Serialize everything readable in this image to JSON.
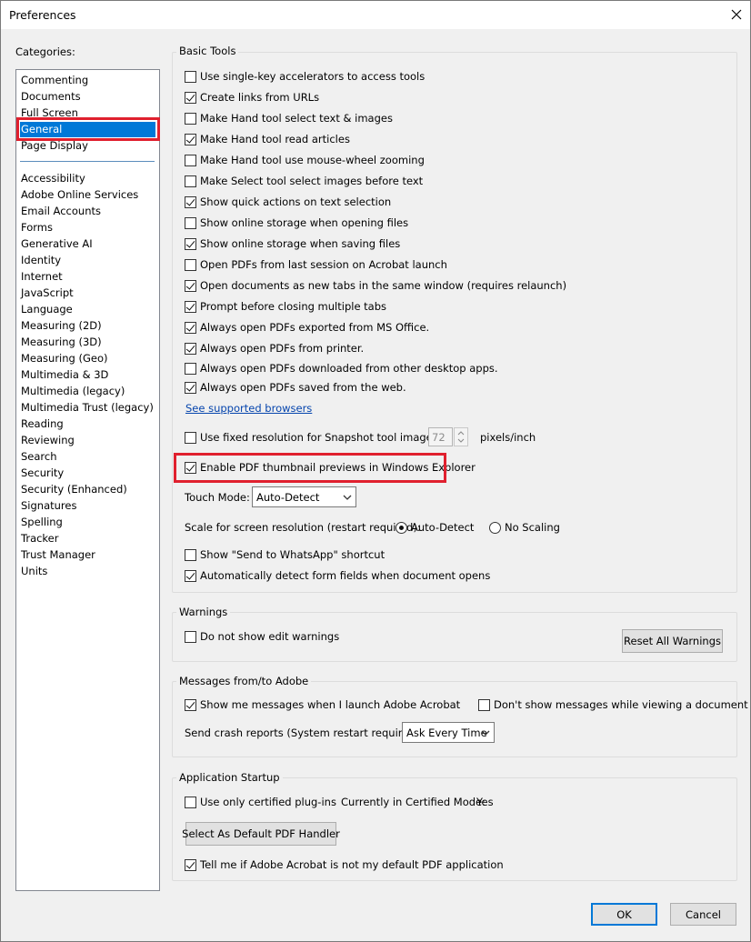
{
  "window": {
    "title": "Preferences"
  },
  "categories": {
    "label": "Categories:",
    "top_items": [
      "Commenting",
      "Documents",
      "Full Screen",
      "General",
      "Page Display"
    ],
    "selected": "General",
    "bottom_items": [
      "Accessibility",
      "Adobe Online Services",
      "Email Accounts",
      "Forms",
      "Generative AI",
      "Identity",
      "Internet",
      "JavaScript",
      "Language",
      "Measuring (2D)",
      "Measuring (3D)",
      "Measuring (Geo)",
      "Multimedia & 3D",
      "Multimedia (legacy)",
      "Multimedia Trust (legacy)",
      "Reading",
      "Reviewing",
      "Search",
      "Security",
      "Security (Enhanced)",
      "Signatures",
      "Spelling",
      "Tracker",
      "Trust Manager",
      "Units"
    ]
  },
  "basic_tools": {
    "title": "Basic Tools",
    "options": [
      {
        "label": "Use single-key accelerators to access tools",
        "checked": false
      },
      {
        "label": "Create links from URLs",
        "checked": true
      },
      {
        "label": "Make Hand tool select text & images",
        "checked": false
      },
      {
        "label": "Make Hand tool read articles",
        "checked": true
      },
      {
        "label": "Make Hand tool use mouse-wheel zooming",
        "checked": false
      },
      {
        "label": "Make Select tool select images before text",
        "checked": false
      },
      {
        "label": "Show quick actions on text selection",
        "checked": true
      },
      {
        "label": "Show online storage when opening files",
        "checked": false
      },
      {
        "label": "Show online storage when saving files",
        "checked": true
      },
      {
        "label": "Open PDFs from last session on Acrobat launch",
        "checked": false
      },
      {
        "label": "Open documents as new tabs in the same window (requires relaunch)",
        "checked": true
      },
      {
        "label": "Prompt before closing multiple tabs",
        "checked": true
      },
      {
        "label": "Always open PDFs exported from MS Office.",
        "checked": true
      },
      {
        "label": "Always open PDFs from printer.",
        "checked": true
      },
      {
        "label": "Always open PDFs downloaded from other desktop apps.",
        "checked": false
      },
      {
        "label": "Always open PDFs saved from the web.",
        "checked": true
      }
    ],
    "browsers_link": "See supported browsers",
    "snapshot": {
      "label": "Use fixed resolution for Snapshot tool images:",
      "checked": false,
      "value": "72",
      "unit": "pixels/inch"
    },
    "thumbnail": {
      "label": "Enable PDF thumbnail previews in Windows Explorer",
      "checked": true
    },
    "touch_mode": {
      "label": "Touch Mode:",
      "value": "Auto-Detect"
    },
    "scale": {
      "label": "Scale for screen resolution (restart required):",
      "auto": "Auto-Detect",
      "none": "No Scaling",
      "selected": "Auto-Detect"
    },
    "whatsapp": {
      "label": "Show \"Send to WhatsApp\" shortcut",
      "checked": false
    },
    "form_fields": {
      "label": "Automatically detect form fields when document opens",
      "checked": true
    }
  },
  "warnings": {
    "title": "Warnings",
    "edit_warnings": {
      "label": "Do not show edit warnings",
      "checked": false
    },
    "reset_button": "Reset All Warnings"
  },
  "messages": {
    "title": "Messages from/to Adobe",
    "launch_messages": {
      "label": "Show me messages when I launch Adobe Acrobat",
      "checked": true
    },
    "viewing_messages": {
      "label": "Don't show messages while viewing a document",
      "checked": false
    },
    "crash_reports": {
      "label": "Send crash reports (System restart required):",
      "value": "Ask Every Time"
    }
  },
  "startup": {
    "title": "Application Startup",
    "certified": {
      "label": "Use only certified plug-ins",
      "checked": false
    },
    "certified_mode_label": "Currently in Certified Mode:",
    "certified_mode_value": "Yes",
    "default_handler_button": "Select As Default PDF Handler",
    "default_app": {
      "label": "Tell me if Adobe Acrobat is not my default PDF application",
      "checked": true
    }
  },
  "footer": {
    "ok": "OK",
    "cancel": "Cancel"
  },
  "colors": {
    "highlight": "#e0202e",
    "selection": "#0078d7"
  }
}
